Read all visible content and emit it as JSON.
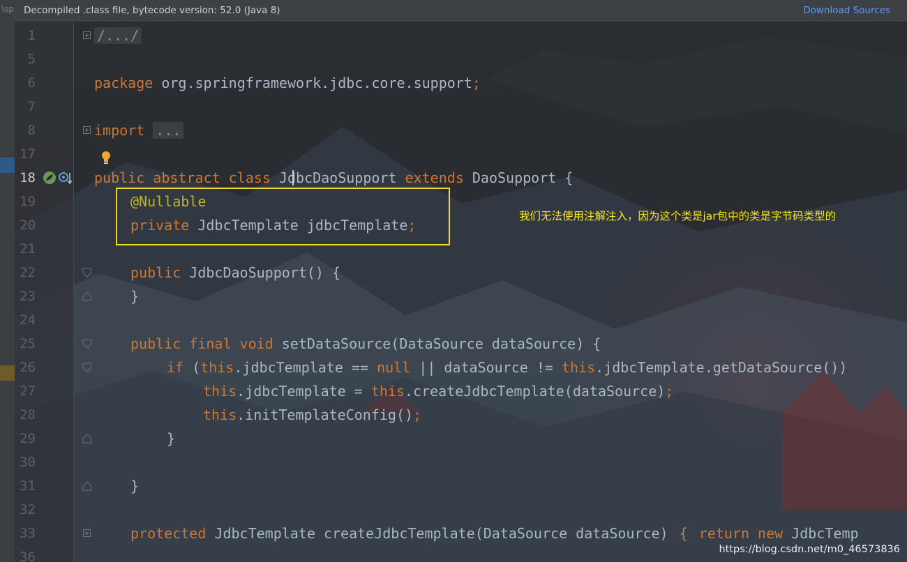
{
  "left_panel": {
    "fragment_text": "\\sp"
  },
  "banner": {
    "message": "Decompiled .class file, bytecode version: 52.0 (Java 8)",
    "download_link": "Download Sources"
  },
  "editor": {
    "caret_line": "18",
    "lines": [
      {
        "n": "1",
        "t": "/.../"
      },
      {
        "n": "5",
        "t": ""
      },
      {
        "n": "6",
        "t": "package org.springframework.jdbc.core.support;"
      },
      {
        "n": "7",
        "t": ""
      },
      {
        "n": "8",
        "t": "import ..."
      },
      {
        "n": "17",
        "t": ""
      },
      {
        "n": "18",
        "t": "public abstract class JdbcDaoSupport extends DaoSupport {"
      },
      {
        "n": "19",
        "t": "    @Nullable"
      },
      {
        "n": "20",
        "t": "    private JdbcTemplate jdbcTemplate;"
      },
      {
        "n": "21",
        "t": ""
      },
      {
        "n": "22",
        "t": "    public JdbcDaoSupport() {"
      },
      {
        "n": "23",
        "t": "    }"
      },
      {
        "n": "24",
        "t": ""
      },
      {
        "n": "25",
        "t": "    public final void setDataSource(DataSource dataSource) {"
      },
      {
        "n": "26",
        "t": "        if (this.jdbcTemplate == null || dataSource != this.jdbcTemplate.getDataSource())"
      },
      {
        "n": "27",
        "t": "            this.jdbcTemplate = this.createJdbcTemplate(dataSource);"
      },
      {
        "n": "28",
        "t": "            this.initTemplateConfig();"
      },
      {
        "n": "29",
        "t": "        }"
      },
      {
        "n": "30",
        "t": ""
      },
      {
        "n": "31",
        "t": "    }"
      },
      {
        "n": "32",
        "t": ""
      },
      {
        "n": "33",
        "t": "    protected JdbcTemplate createJdbcTemplate(DataSource dataSource) { return new JdbcTemp"
      },
      {
        "n": "36",
        "t": ""
      }
    ],
    "tokens": {
      "l1": "/.../",
      "l6_kw": "package",
      "l6_rest": " org.springframework.jdbc.core.support",
      "l6_semi": ";",
      "l8_kw": "import",
      "l8_fold": "...",
      "l18_kw": "public abstract class",
      "l18_cls": "JdbcDaoSupport",
      "l18_ext": "extends",
      "l18_rest": " DaoSupport {",
      "l19_ann": "@Nullable",
      "l20_kw": "private",
      "l20_rest": " JdbcTemplate jdbcTemplate",
      "l20_semi": ";",
      "l22_kw": "public",
      "l22_rest": " JdbcDaoSupport() {",
      "l23": "}",
      "l25_kw": "public final void",
      "l25_fn": "setDataSource",
      "l25_rest": "(DataSource dataSource) {",
      "l26_kw": "if",
      "l26_a": " (",
      "l26_this1": "this",
      "l26_b": ".jdbcTemplate == ",
      "l26_null": "null",
      "l26_c": " || dataSource != ",
      "l26_this2": "this",
      "l26_d": ".jdbcTemplate.getDataSource())",
      "l27_this1": "this",
      "l27_a": ".jdbcTemplate = ",
      "l27_this2": "this",
      "l27_b": ".createJdbcTemplate(dataSource)",
      "l27_semi": ";",
      "l28_this": "this",
      "l28_a": ".initTemplateConfig()",
      "l28_semi": ";",
      "l29": "}",
      "l31": "}",
      "l33_kw": "protected",
      "l33_rest": " JdbcTemplate createJdbcTemplate(DataSource dataSource) ",
      "l33_fold": "{",
      "l33_ret": "return new",
      "l33_tail": " JdbcTemp"
    }
  },
  "annotation_note": "我们无法使用注解注入，因为这个类是jar包中的类是字节码类型的",
  "watermark": "https://blog.csdn.net/m0_46573836",
  "colors": {
    "keyword": "#cc7832",
    "annotation": "#bbb529",
    "default_code": "#a9b7c6",
    "highlight_box": "#f2dc1b",
    "link": "#589df6"
  },
  "icons": [
    "spring-bean-icon",
    "implements-icon",
    "intention-bulb-icon",
    "fold-expand-icon",
    "fold-collapse-icon"
  ]
}
